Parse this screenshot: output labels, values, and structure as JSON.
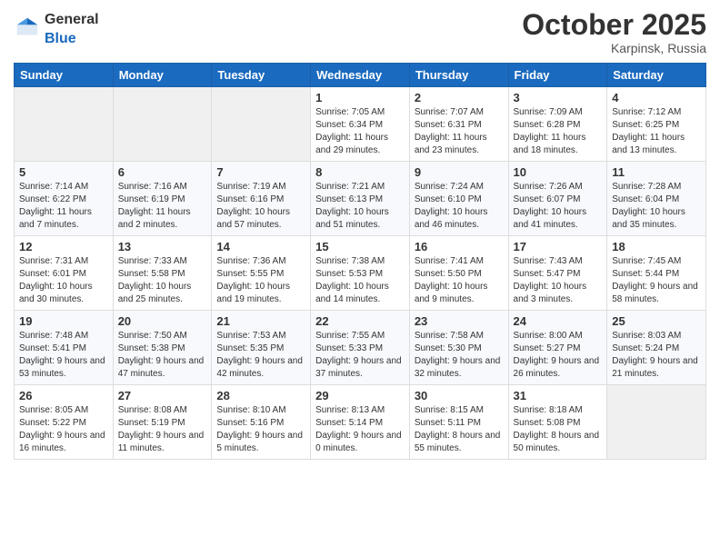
{
  "logo": {
    "general": "General",
    "blue": "Blue"
  },
  "header": {
    "month": "October 2025",
    "location": "Karpinsk, Russia"
  },
  "weekdays": [
    "Sunday",
    "Monday",
    "Tuesday",
    "Wednesday",
    "Thursday",
    "Friday",
    "Saturday"
  ],
  "weeks": [
    [
      {
        "day": "",
        "sunrise": "",
        "sunset": "",
        "daylight": ""
      },
      {
        "day": "",
        "sunrise": "",
        "sunset": "",
        "daylight": ""
      },
      {
        "day": "",
        "sunrise": "",
        "sunset": "",
        "daylight": ""
      },
      {
        "day": "1",
        "sunrise": "Sunrise: 7:05 AM",
        "sunset": "Sunset: 6:34 PM",
        "daylight": "Daylight: 11 hours and 29 minutes."
      },
      {
        "day": "2",
        "sunrise": "Sunrise: 7:07 AM",
        "sunset": "Sunset: 6:31 PM",
        "daylight": "Daylight: 11 hours and 23 minutes."
      },
      {
        "day": "3",
        "sunrise": "Sunrise: 7:09 AM",
        "sunset": "Sunset: 6:28 PM",
        "daylight": "Daylight: 11 hours and 18 minutes."
      },
      {
        "day": "4",
        "sunrise": "Sunrise: 7:12 AM",
        "sunset": "Sunset: 6:25 PM",
        "daylight": "Daylight: 11 hours and 13 minutes."
      }
    ],
    [
      {
        "day": "5",
        "sunrise": "Sunrise: 7:14 AM",
        "sunset": "Sunset: 6:22 PM",
        "daylight": "Daylight: 11 hours and 7 minutes."
      },
      {
        "day": "6",
        "sunrise": "Sunrise: 7:16 AM",
        "sunset": "Sunset: 6:19 PM",
        "daylight": "Daylight: 11 hours and 2 minutes."
      },
      {
        "day": "7",
        "sunrise": "Sunrise: 7:19 AM",
        "sunset": "Sunset: 6:16 PM",
        "daylight": "Daylight: 10 hours and 57 minutes."
      },
      {
        "day": "8",
        "sunrise": "Sunrise: 7:21 AM",
        "sunset": "Sunset: 6:13 PM",
        "daylight": "Daylight: 10 hours and 51 minutes."
      },
      {
        "day": "9",
        "sunrise": "Sunrise: 7:24 AM",
        "sunset": "Sunset: 6:10 PM",
        "daylight": "Daylight: 10 hours and 46 minutes."
      },
      {
        "day": "10",
        "sunrise": "Sunrise: 7:26 AM",
        "sunset": "Sunset: 6:07 PM",
        "daylight": "Daylight: 10 hours and 41 minutes."
      },
      {
        "day": "11",
        "sunrise": "Sunrise: 7:28 AM",
        "sunset": "Sunset: 6:04 PM",
        "daylight": "Daylight: 10 hours and 35 minutes."
      }
    ],
    [
      {
        "day": "12",
        "sunrise": "Sunrise: 7:31 AM",
        "sunset": "Sunset: 6:01 PM",
        "daylight": "Daylight: 10 hours and 30 minutes."
      },
      {
        "day": "13",
        "sunrise": "Sunrise: 7:33 AM",
        "sunset": "Sunset: 5:58 PM",
        "daylight": "Daylight: 10 hours and 25 minutes."
      },
      {
        "day": "14",
        "sunrise": "Sunrise: 7:36 AM",
        "sunset": "Sunset: 5:55 PM",
        "daylight": "Daylight: 10 hours and 19 minutes."
      },
      {
        "day": "15",
        "sunrise": "Sunrise: 7:38 AM",
        "sunset": "Sunset: 5:53 PM",
        "daylight": "Daylight: 10 hours and 14 minutes."
      },
      {
        "day": "16",
        "sunrise": "Sunrise: 7:41 AM",
        "sunset": "Sunset: 5:50 PM",
        "daylight": "Daylight: 10 hours and 9 minutes."
      },
      {
        "day": "17",
        "sunrise": "Sunrise: 7:43 AM",
        "sunset": "Sunset: 5:47 PM",
        "daylight": "Daylight: 10 hours and 3 minutes."
      },
      {
        "day": "18",
        "sunrise": "Sunrise: 7:45 AM",
        "sunset": "Sunset: 5:44 PM",
        "daylight": "Daylight: 9 hours and 58 minutes."
      }
    ],
    [
      {
        "day": "19",
        "sunrise": "Sunrise: 7:48 AM",
        "sunset": "Sunset: 5:41 PM",
        "daylight": "Daylight: 9 hours and 53 minutes."
      },
      {
        "day": "20",
        "sunrise": "Sunrise: 7:50 AM",
        "sunset": "Sunset: 5:38 PM",
        "daylight": "Daylight: 9 hours and 47 minutes."
      },
      {
        "day": "21",
        "sunrise": "Sunrise: 7:53 AM",
        "sunset": "Sunset: 5:35 PM",
        "daylight": "Daylight: 9 hours and 42 minutes."
      },
      {
        "day": "22",
        "sunrise": "Sunrise: 7:55 AM",
        "sunset": "Sunset: 5:33 PM",
        "daylight": "Daylight: 9 hours and 37 minutes."
      },
      {
        "day": "23",
        "sunrise": "Sunrise: 7:58 AM",
        "sunset": "Sunset: 5:30 PM",
        "daylight": "Daylight: 9 hours and 32 minutes."
      },
      {
        "day": "24",
        "sunrise": "Sunrise: 8:00 AM",
        "sunset": "Sunset: 5:27 PM",
        "daylight": "Daylight: 9 hours and 26 minutes."
      },
      {
        "day": "25",
        "sunrise": "Sunrise: 8:03 AM",
        "sunset": "Sunset: 5:24 PM",
        "daylight": "Daylight: 9 hours and 21 minutes."
      }
    ],
    [
      {
        "day": "26",
        "sunrise": "Sunrise: 8:05 AM",
        "sunset": "Sunset: 5:22 PM",
        "daylight": "Daylight: 9 hours and 16 minutes."
      },
      {
        "day": "27",
        "sunrise": "Sunrise: 8:08 AM",
        "sunset": "Sunset: 5:19 PM",
        "daylight": "Daylight: 9 hours and 11 minutes."
      },
      {
        "day": "28",
        "sunrise": "Sunrise: 8:10 AM",
        "sunset": "Sunset: 5:16 PM",
        "daylight": "Daylight: 9 hours and 5 minutes."
      },
      {
        "day": "29",
        "sunrise": "Sunrise: 8:13 AM",
        "sunset": "Sunset: 5:14 PM",
        "daylight": "Daylight: 9 hours and 0 minutes."
      },
      {
        "day": "30",
        "sunrise": "Sunrise: 8:15 AM",
        "sunset": "Sunset: 5:11 PM",
        "daylight": "Daylight: 8 hours and 55 minutes."
      },
      {
        "day": "31",
        "sunrise": "Sunrise: 8:18 AM",
        "sunset": "Sunset: 5:08 PM",
        "daylight": "Daylight: 8 hours and 50 minutes."
      },
      {
        "day": "",
        "sunrise": "",
        "sunset": "",
        "daylight": ""
      }
    ]
  ]
}
